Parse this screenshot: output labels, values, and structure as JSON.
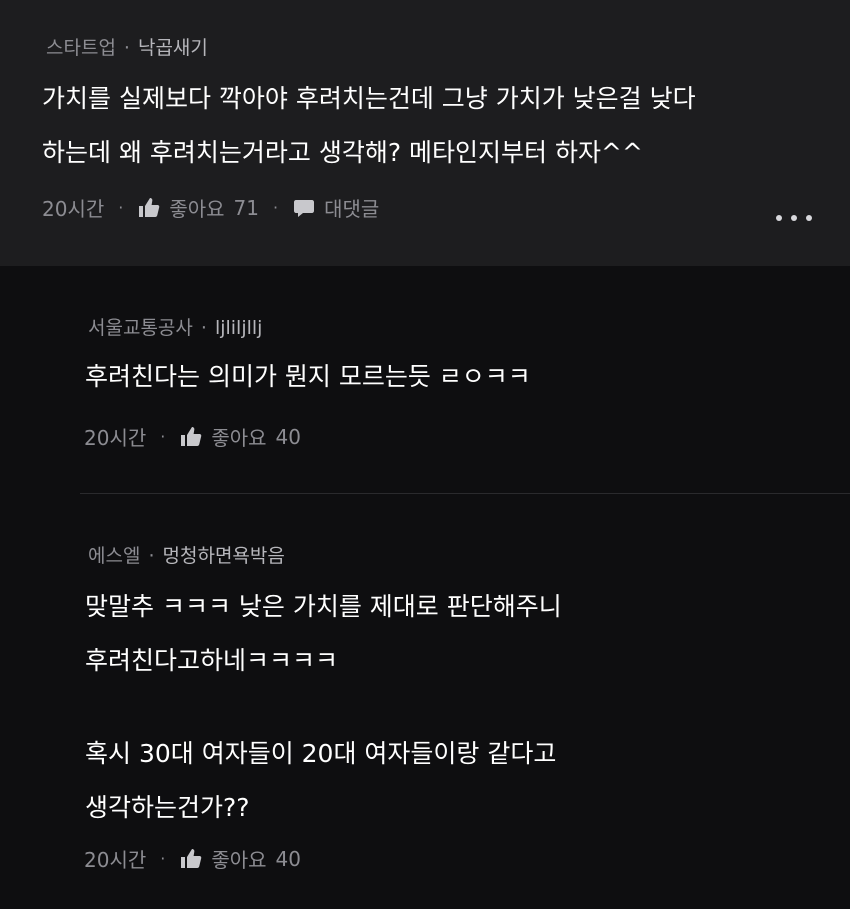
{
  "comments": [
    {
      "category": "스타트업",
      "nickname": "낙곱새기",
      "lines": [
        "가치를 실제보다 깍아야 후려치는건데 그냥 가치가 낮은걸 낮다",
        "하는데 왜 후려치는거라고 생각해? 메타인지부터 하자^^"
      ],
      "time": "20시간",
      "like_label": "좋아요",
      "likes": "71",
      "reply_label": "대댓글"
    },
    {
      "category": "서울교통공사",
      "nickname": "ljliljllj",
      "lines": [
        "후려친다는 의미가 뭔지 모르는듯 ㄹㅇㅋㅋ"
      ],
      "time": "20시간",
      "like_label": "좋아요",
      "likes": "40"
    },
    {
      "category": "에스엘",
      "nickname": "멍청하면욕박음",
      "lines": [
        "맞말추 ㅋㅋㅋ 낮은 가치를 제대로 판단해주니",
        "후려친다고하네ㅋㅋㅋㅋ",
        "",
        "혹시 30대 여자들이 20대 여자들이랑 같다고",
        "생각하는건가??"
      ],
      "time": "20시간",
      "like_label": "좋아요",
      "likes": "40"
    }
  ],
  "separator": "·",
  "icons": {
    "like": "thumbs-up-icon",
    "reply": "speech-bubble-icon",
    "more": "more-horizontal-icon"
  },
  "colors": {
    "background": "#0e0e10",
    "main_comment_bg": "#1d1d1f",
    "meta_text": "#8c8c92",
    "body_text": "#ffffff"
  }
}
